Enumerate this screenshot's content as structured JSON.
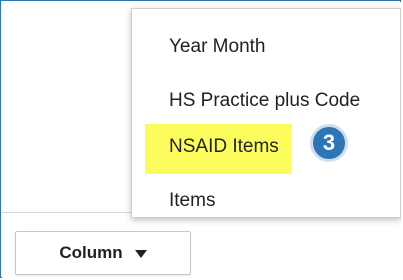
{
  "menu": {
    "items": [
      {
        "label": "Year Month"
      },
      {
        "label": "HS Practice plus Code"
      },
      {
        "label": "NSAID Items",
        "highlighted": true
      },
      {
        "label": "Items"
      }
    ]
  },
  "step_badge": {
    "number": "3"
  },
  "column_button": {
    "label": "Column",
    "icon": "caret-down-icon"
  },
  "colors": {
    "frame_border": "#2e75b6",
    "highlight": "#fcfc5c",
    "badge": "#2e75b6"
  }
}
